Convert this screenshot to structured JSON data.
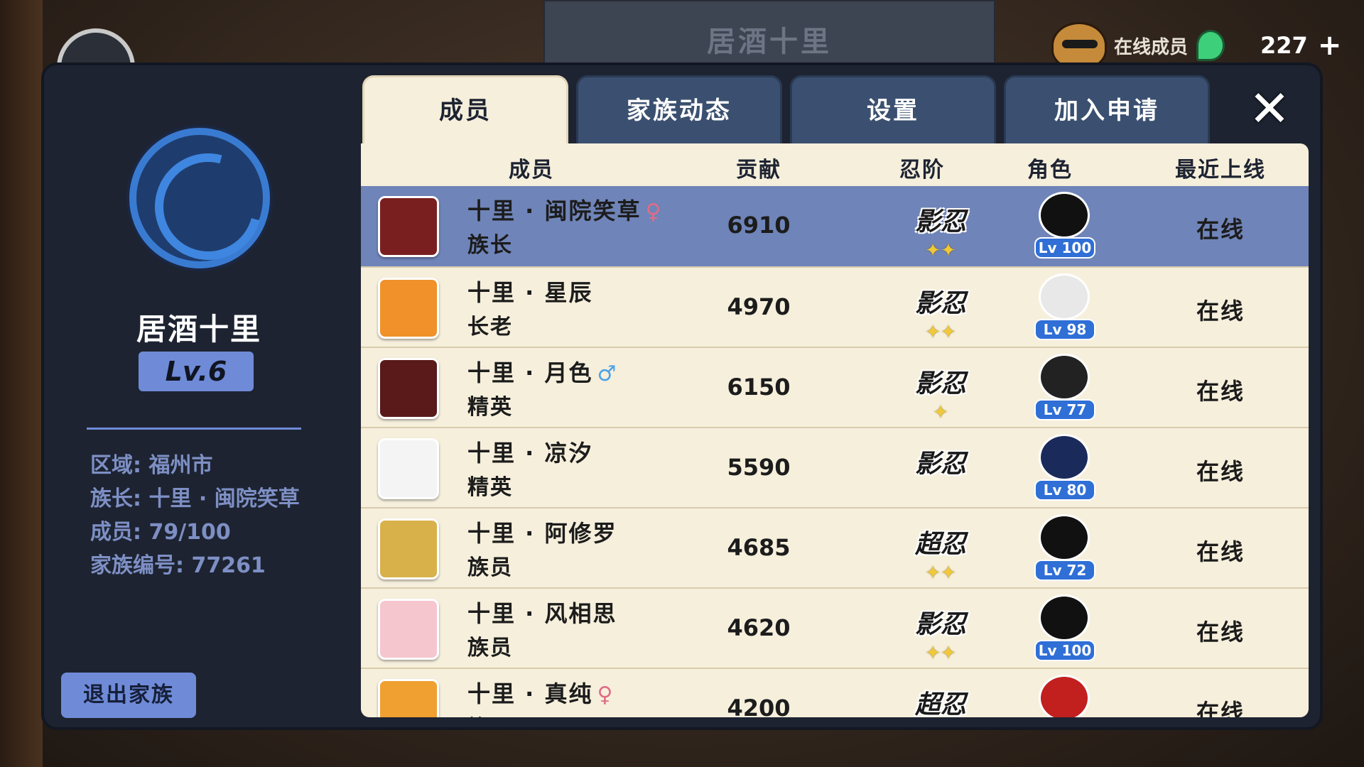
{
  "background": {
    "banner_title": "居酒十里",
    "online_label": "在线成员",
    "currency_count": "227",
    "plus_symbol": "+"
  },
  "sidebar": {
    "clan_name": "居酒十里",
    "level": "Lv.6",
    "info": [
      "区域: 福州市",
      "族长: 十里 · 闽院笑草",
      "成员: 79/100",
      "家族编号: 77261"
    ],
    "leave_label": "退出家族"
  },
  "tabs": [
    {
      "label": "成员",
      "active": true
    },
    {
      "label": "家族动态",
      "active": false
    },
    {
      "label": "设置",
      "active": false
    },
    {
      "label": "加入申请",
      "active": false
    }
  ],
  "close_symbol": "✕",
  "table": {
    "headers": {
      "member": "成员",
      "contribution": "贡献",
      "rank": "忍阶",
      "character": "角色",
      "last_online": "最近上线"
    },
    "rows": [
      {
        "name": "十里 · 闽院笑草",
        "gender": "♀",
        "gender_type": "f",
        "role": "族长",
        "contribution": "6910",
        "rank": "影忍",
        "stars": "✦✦",
        "level": "Lv 100",
        "last_online": "在线",
        "avatar_color": "#7a1f1f",
        "char_color": "#111111"
      },
      {
        "name": "十里 · 星辰",
        "gender": "",
        "gender_type": "",
        "role": "长老",
        "contribution": "4970",
        "rank": "影忍",
        "stars": "✦✦",
        "level": "Lv 98",
        "last_online": "在线",
        "avatar_color": "#f0912a",
        "char_color": "#e8e8e8"
      },
      {
        "name": "十里 · 月色",
        "gender": "♂",
        "gender_type": "m",
        "role": "精英",
        "contribution": "6150",
        "rank": "影忍",
        "stars": "✦",
        "level": "Lv 77",
        "last_online": "在线",
        "avatar_color": "#5a1a1a",
        "char_color": "#222222"
      },
      {
        "name": "十里 · 凉汐",
        "gender": "",
        "gender_type": "",
        "role": "精英",
        "contribution": "5590",
        "rank": "影忍",
        "stars": "",
        "level": "Lv 80",
        "last_online": "在线",
        "avatar_color": "#f4f4f4",
        "char_color": "#1a2a5a"
      },
      {
        "name": "十里 · 阿修罗",
        "gender": "",
        "gender_type": "",
        "role": "族员",
        "contribution": "4685",
        "rank": "超忍",
        "stars": "✦✦",
        "level": "Lv 72",
        "last_online": "在线",
        "avatar_color": "#d9b14a",
        "char_color": "#111111"
      },
      {
        "name": "十里 · 风相思",
        "gender": "",
        "gender_type": "",
        "role": "族员",
        "contribution": "4620",
        "rank": "影忍",
        "stars": "✦✦",
        "level": "Lv 100",
        "last_online": "在线",
        "avatar_color": "#f6c6cf",
        "char_color": "#111111"
      },
      {
        "name": "十里 · 真纯",
        "gender": "♀",
        "gender_type": "f",
        "role": "族员",
        "contribution": "4200",
        "rank": "超忍",
        "stars": "",
        "level": "",
        "last_online": "在线",
        "avatar_color": "#f0a030",
        "char_color": "#c21f1f"
      }
    ]
  }
}
